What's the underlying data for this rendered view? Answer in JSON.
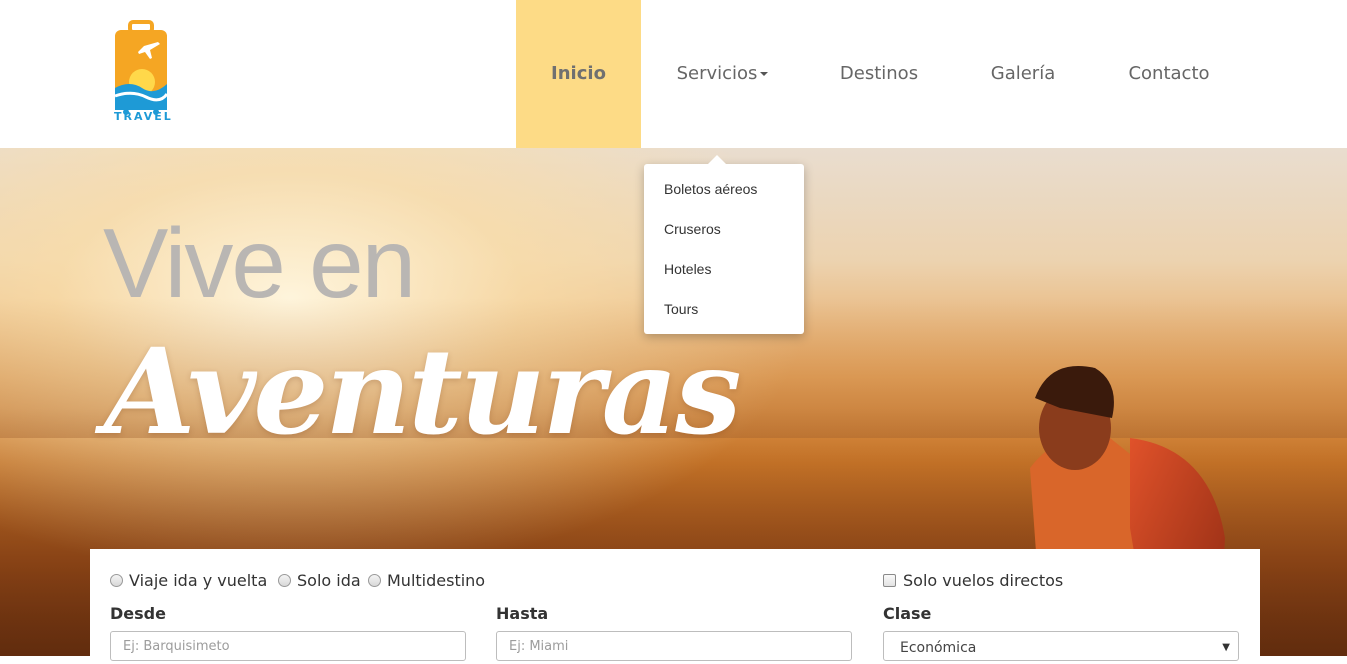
{
  "brand": {
    "logo_text": "TRAVEL"
  },
  "nav": {
    "items": [
      {
        "label": "Inicio"
      },
      {
        "label": "Servicios"
      },
      {
        "label": "Destinos"
      },
      {
        "label": "Galería"
      },
      {
        "label": "Contacto"
      }
    ]
  },
  "dropdown": {
    "items": [
      {
        "label": "Boletos aéreos"
      },
      {
        "label": "Cruseros"
      },
      {
        "label": "Hoteles"
      },
      {
        "label": "Tours"
      }
    ]
  },
  "hero": {
    "title_line1": "Vive en",
    "title_line2": "Aventuras"
  },
  "search": {
    "trip_types": [
      {
        "label": "Viaje ida y vuelta"
      },
      {
        "label": "Solo ida"
      },
      {
        "label": "Multidestino"
      }
    ],
    "direct_flights_label": "Solo vuelos directos",
    "from": {
      "label": "Desde",
      "placeholder": "Ej: Barquisimeto"
    },
    "to": {
      "label": "Hasta",
      "placeholder": "Ej: Miami"
    },
    "class": {
      "label": "Clase",
      "selected": "Económica"
    }
  },
  "colors": {
    "nav_active_bg": "#fddb86",
    "logo_orange": "#f5a623",
    "logo_blue": "#1e9ad6"
  }
}
